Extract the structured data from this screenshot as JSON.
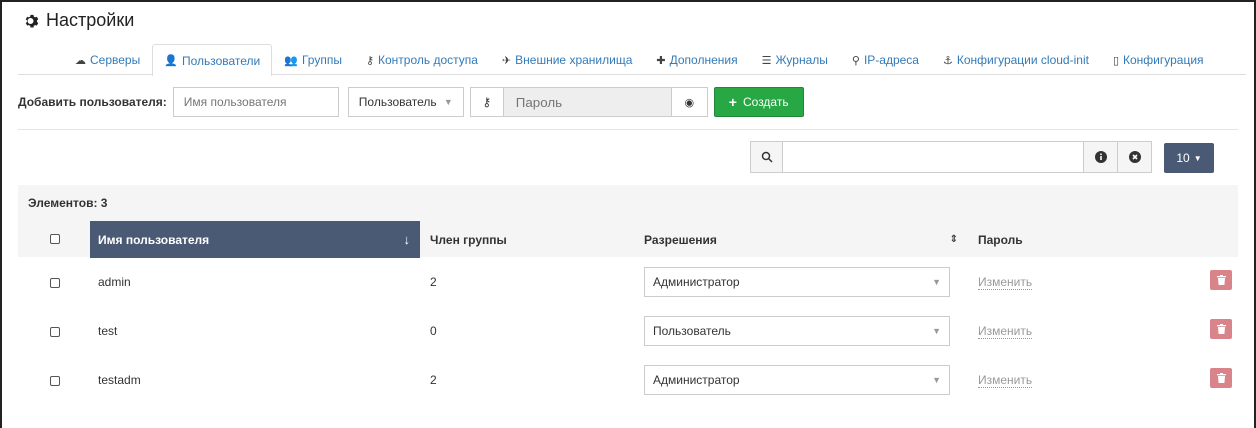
{
  "page_title": "Настройки",
  "tabs": [
    {
      "label": "Серверы",
      "icon": "cloud-icon"
    },
    {
      "label": "Пользователи",
      "icon": "user-icon",
      "active": true
    },
    {
      "label": "Группы",
      "icon": "users-icon"
    },
    {
      "label": "Контроль доступа",
      "icon": "key-icon"
    },
    {
      "label": "Внешние хранилища",
      "icon": "rocket-icon"
    },
    {
      "label": "Дополнения",
      "icon": "puzzle-icon"
    },
    {
      "label": "Журналы",
      "icon": "list-icon"
    },
    {
      "label": "IP-адреса",
      "icon": "map-marker-icon"
    },
    {
      "label": "Конфигурации cloud-init",
      "icon": "pin-icon"
    },
    {
      "label": "Конфигурация",
      "icon": "file-icon"
    }
  ],
  "add_user": {
    "label": "Добавить пользователя:",
    "username_placeholder": "Имя пользователя",
    "role_value": "Пользователь",
    "password_placeholder": "Пароль",
    "create_label": "Создать"
  },
  "toolbar": {
    "page_size": "10"
  },
  "table": {
    "count_label": "Элементов: 3",
    "columns": {
      "username": "Имя пользователя",
      "group_member": "Член группы",
      "permissions": "Разрешения",
      "password": "Пароль"
    },
    "rows": [
      {
        "username": "admin",
        "groups": "2",
        "permission": "Администратор",
        "password_action": "Изменить"
      },
      {
        "username": "test",
        "groups": "0",
        "permission": "Пользователь",
        "password_action": "Изменить"
      },
      {
        "username": "testadm",
        "groups": "2",
        "permission": "Администратор",
        "password_action": "Изменить"
      }
    ]
  },
  "colors": {
    "accent": "#337ab7",
    "create_button": "#28a745",
    "sorted_header": "#4a5a75",
    "delete_button": "#d9848b"
  }
}
